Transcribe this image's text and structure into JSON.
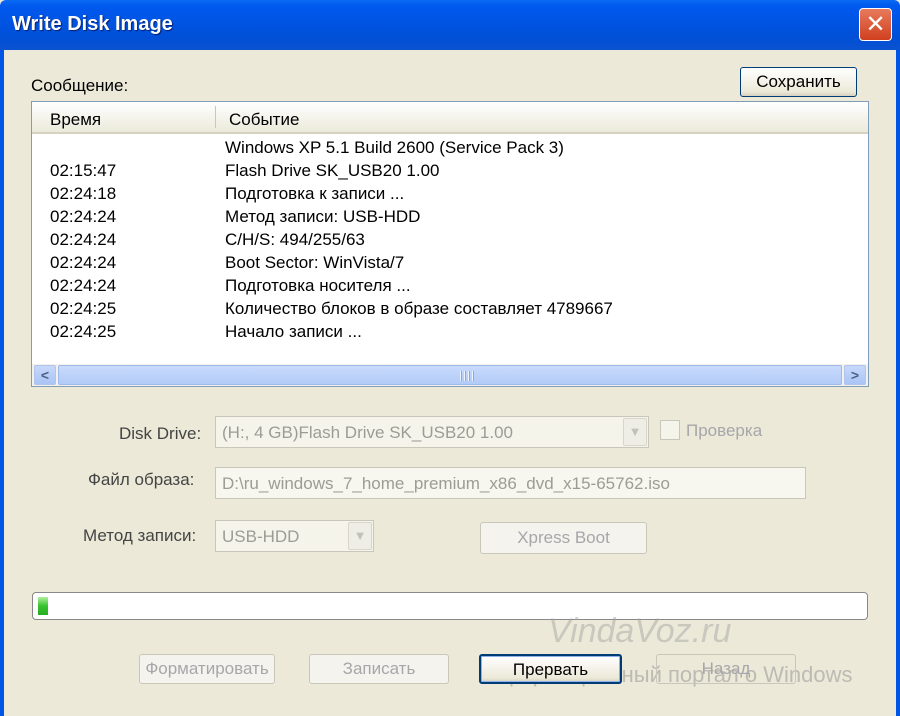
{
  "window": {
    "title": "Write Disk Image",
    "close_symbol": "✕"
  },
  "message": {
    "label": "Сообщение:",
    "save_button": "Сохранить"
  },
  "log": {
    "columns": [
      "Время",
      "Событие"
    ],
    "rows": [
      {
        "time": "",
        "event": "Windows XP 5.1 Build 2600 (Service Pack 3)"
      },
      {
        "time": "02:15:47",
        "event": "Flash   Drive SK_USB20  1.00"
      },
      {
        "time": "02:24:18",
        "event": "Подготовка к записи ..."
      },
      {
        "time": "02:24:24",
        "event": "Метод записи: USB-HDD"
      },
      {
        "time": "02:24:24",
        "event": "C/H/S: 494/255/63"
      },
      {
        "time": "02:24:24",
        "event": "Boot Sector: WinVista/7"
      },
      {
        "time": "02:24:24",
        "event": "Подготовка носителя ..."
      },
      {
        "time": "02:24:25",
        "event": "Количество блоков в образе составляет 4789667"
      },
      {
        "time": "02:24:25",
        "event": "Начало записи ..."
      }
    ],
    "scroll_left": "<",
    "scroll_right": ">"
  },
  "form": {
    "disk_drive_label": "Disk Drive:",
    "disk_drive_value": "(H:, 4 GB)Flash   Drive SK_USB20  1.00",
    "verify_label": "Проверка",
    "image_file_label": "Файл образа:",
    "image_file_value": "D:\\ru_windows_7_home_premium_x86_dvd_x15-65762.iso",
    "write_method_label": "Метод записи:",
    "write_method_value": "USB-HDD",
    "xpress_boot_button": "Xpress Boot"
  },
  "progress": {
    "value": 0.012,
    "color": "#37c22f"
  },
  "buttons": {
    "format": "Форматировать",
    "write": "Записать",
    "abort": "Прервать",
    "back": "Назад"
  },
  "watermark": {
    "line1": "VindaVoz.ru",
    "line2": "информационный портал о Windows"
  }
}
